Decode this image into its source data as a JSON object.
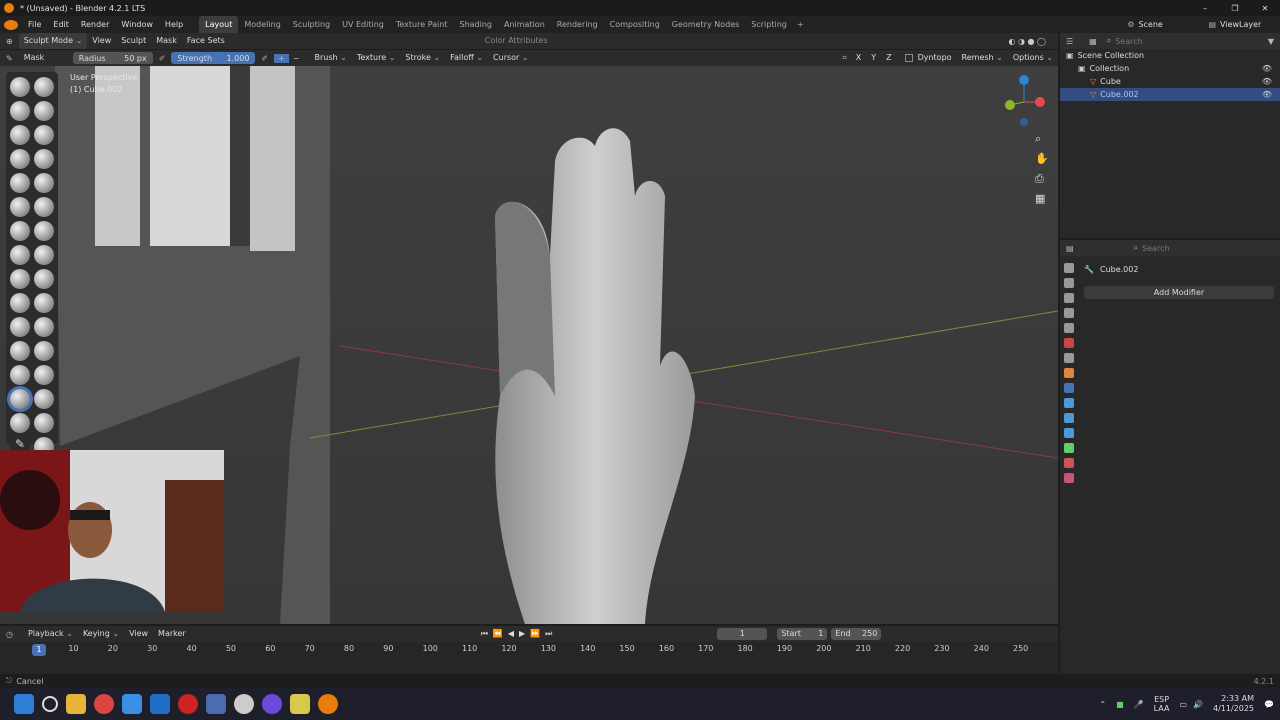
{
  "title": "* (Unsaved) - Blender 4.2.1 LTS",
  "menu": [
    "File",
    "Edit",
    "Render",
    "Window",
    "Help"
  ],
  "workspaces": [
    "Layout",
    "Modeling",
    "Sculpting",
    "UV Editing",
    "Texture Paint",
    "Shading",
    "Animation",
    "Rendering",
    "Compositing",
    "Geometry Nodes",
    "Scripting"
  ],
  "active_workspace": "Layout",
  "scene": "Scene",
  "view_layer": "ViewLayer",
  "vp_header": {
    "mode": "Sculpt Mode",
    "items": [
      "View",
      "Sculpt",
      "Mask",
      "Face Sets"
    ],
    "color_attr": "Color Attributes"
  },
  "tool_header": {
    "tool": "Mask",
    "radius_label": "Radius",
    "radius": "50 px",
    "strength_label": "Strength",
    "strength": "1.000",
    "strength_fraction": 1.0,
    "menus": [
      "Brush",
      "Texture",
      "Stroke",
      "Falloff",
      "Cursor"
    ],
    "axes": [
      "X",
      "Y",
      "Z"
    ],
    "dyntopo": "Dyntopo",
    "remesh": "Remesh",
    "options": "Options"
  },
  "viewport": {
    "perspective": "User Perspective",
    "object": "(1) Cube.002"
  },
  "outliner": {
    "search": "Search",
    "rows": [
      {
        "label": "Scene Collection"
      },
      {
        "label": "Collection"
      },
      {
        "label": "Cube"
      },
      {
        "label": "Cube.002",
        "selected": true
      }
    ]
  },
  "properties": {
    "search": "Search",
    "object": "Cube.002",
    "add_modifier": "Add Modifier"
  },
  "timeline": {
    "menus": [
      "Playback",
      "Keying",
      "View",
      "Marker"
    ],
    "current": "1",
    "start_label": "Start",
    "start": "1",
    "end_label": "End",
    "end": "250",
    "ticks": [
      "10",
      "20",
      "30",
      "40",
      "50",
      "60",
      "70",
      "80",
      "90",
      "100",
      "110",
      "120",
      "130",
      "140",
      "150",
      "160",
      "170",
      "180",
      "190",
      "200",
      "210",
      "220",
      "230",
      "240",
      "250"
    ]
  },
  "status": {
    "left": "Cancel",
    "version": "4.2.1"
  },
  "taskbar": {
    "lang1": "ESP",
    "lang2": "LAA",
    "time": "2:33 AM",
    "date": "4/11/2025"
  },
  "colors": {
    "accent": "#4772b3",
    "selected": "#334d80",
    "x_axis": "#e34b4b",
    "y_axis": "#8ab82e",
    "z_axis": "#2f83e0"
  }
}
